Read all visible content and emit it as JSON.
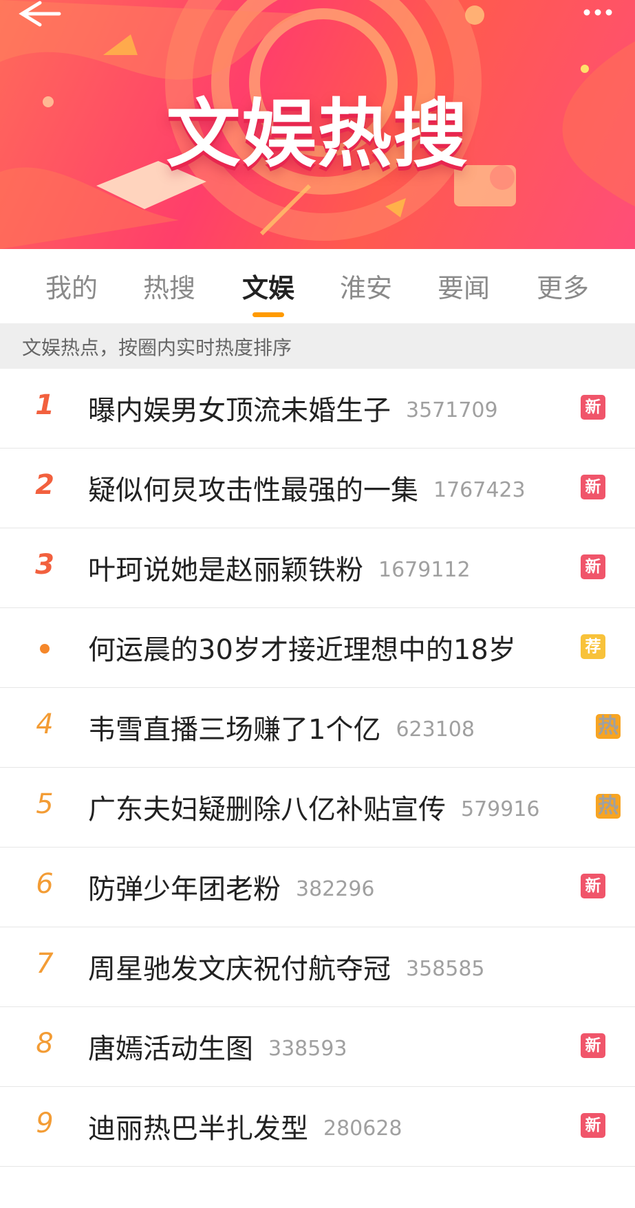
{
  "banner": {
    "title": "文娱热搜",
    "back_icon": "arrow-left-icon",
    "more_icon": "more-dots-icon"
  },
  "tabs": [
    {
      "label": "我的",
      "active": false
    },
    {
      "label": "热搜",
      "active": false
    },
    {
      "label": "文娱",
      "active": true
    },
    {
      "label": "淮安",
      "active": false
    },
    {
      "label": "要闻",
      "active": false
    },
    {
      "label": "更多",
      "active": false
    }
  ],
  "subtitle": "文娱热点，按圈内实时热度排序",
  "colors": {
    "accent": "#ff9a00",
    "badge_new": "#f0556a",
    "badge_hot": "#f7a422",
    "badge_rec": "#f8c23a",
    "rank_top": "#f2603e",
    "rank_low": "#f39c35"
  },
  "items": [
    {
      "rank": "1",
      "title": "曝内娱男女顶流未婚生子",
      "hot": "3571709",
      "badge": "新"
    },
    {
      "rank": "2",
      "title": "疑似何炅攻击性最强的一集",
      "hot": "1767423",
      "badge": "新"
    },
    {
      "rank": "3",
      "title": "叶珂说她是赵丽颖铁粉",
      "hot": "1679112",
      "badge": "新"
    },
    {
      "rank": "",
      "title": "何运晨的30岁才接近理想中的18岁",
      "hot": "",
      "badge": "荐"
    },
    {
      "rank": "4",
      "title": "韦雪直播三场赚了1个亿",
      "hot": "623108",
      "badge": "热"
    },
    {
      "rank": "5",
      "title": "广东夫妇疑删除八亿补贴宣传",
      "hot": "579916",
      "badge": "热"
    },
    {
      "rank": "6",
      "title": "防弹少年团老粉",
      "hot": "382296",
      "badge": "新"
    },
    {
      "rank": "7",
      "title": "周星驰发文庆祝付航夺冠",
      "hot": "358585",
      "badge": ""
    },
    {
      "rank": "8",
      "title": "唐嫣活动生图",
      "hot": "338593",
      "badge": "新"
    },
    {
      "rank": "9",
      "title": "迪丽热巴半扎发型",
      "hot": "280628",
      "badge": "新"
    }
  ]
}
